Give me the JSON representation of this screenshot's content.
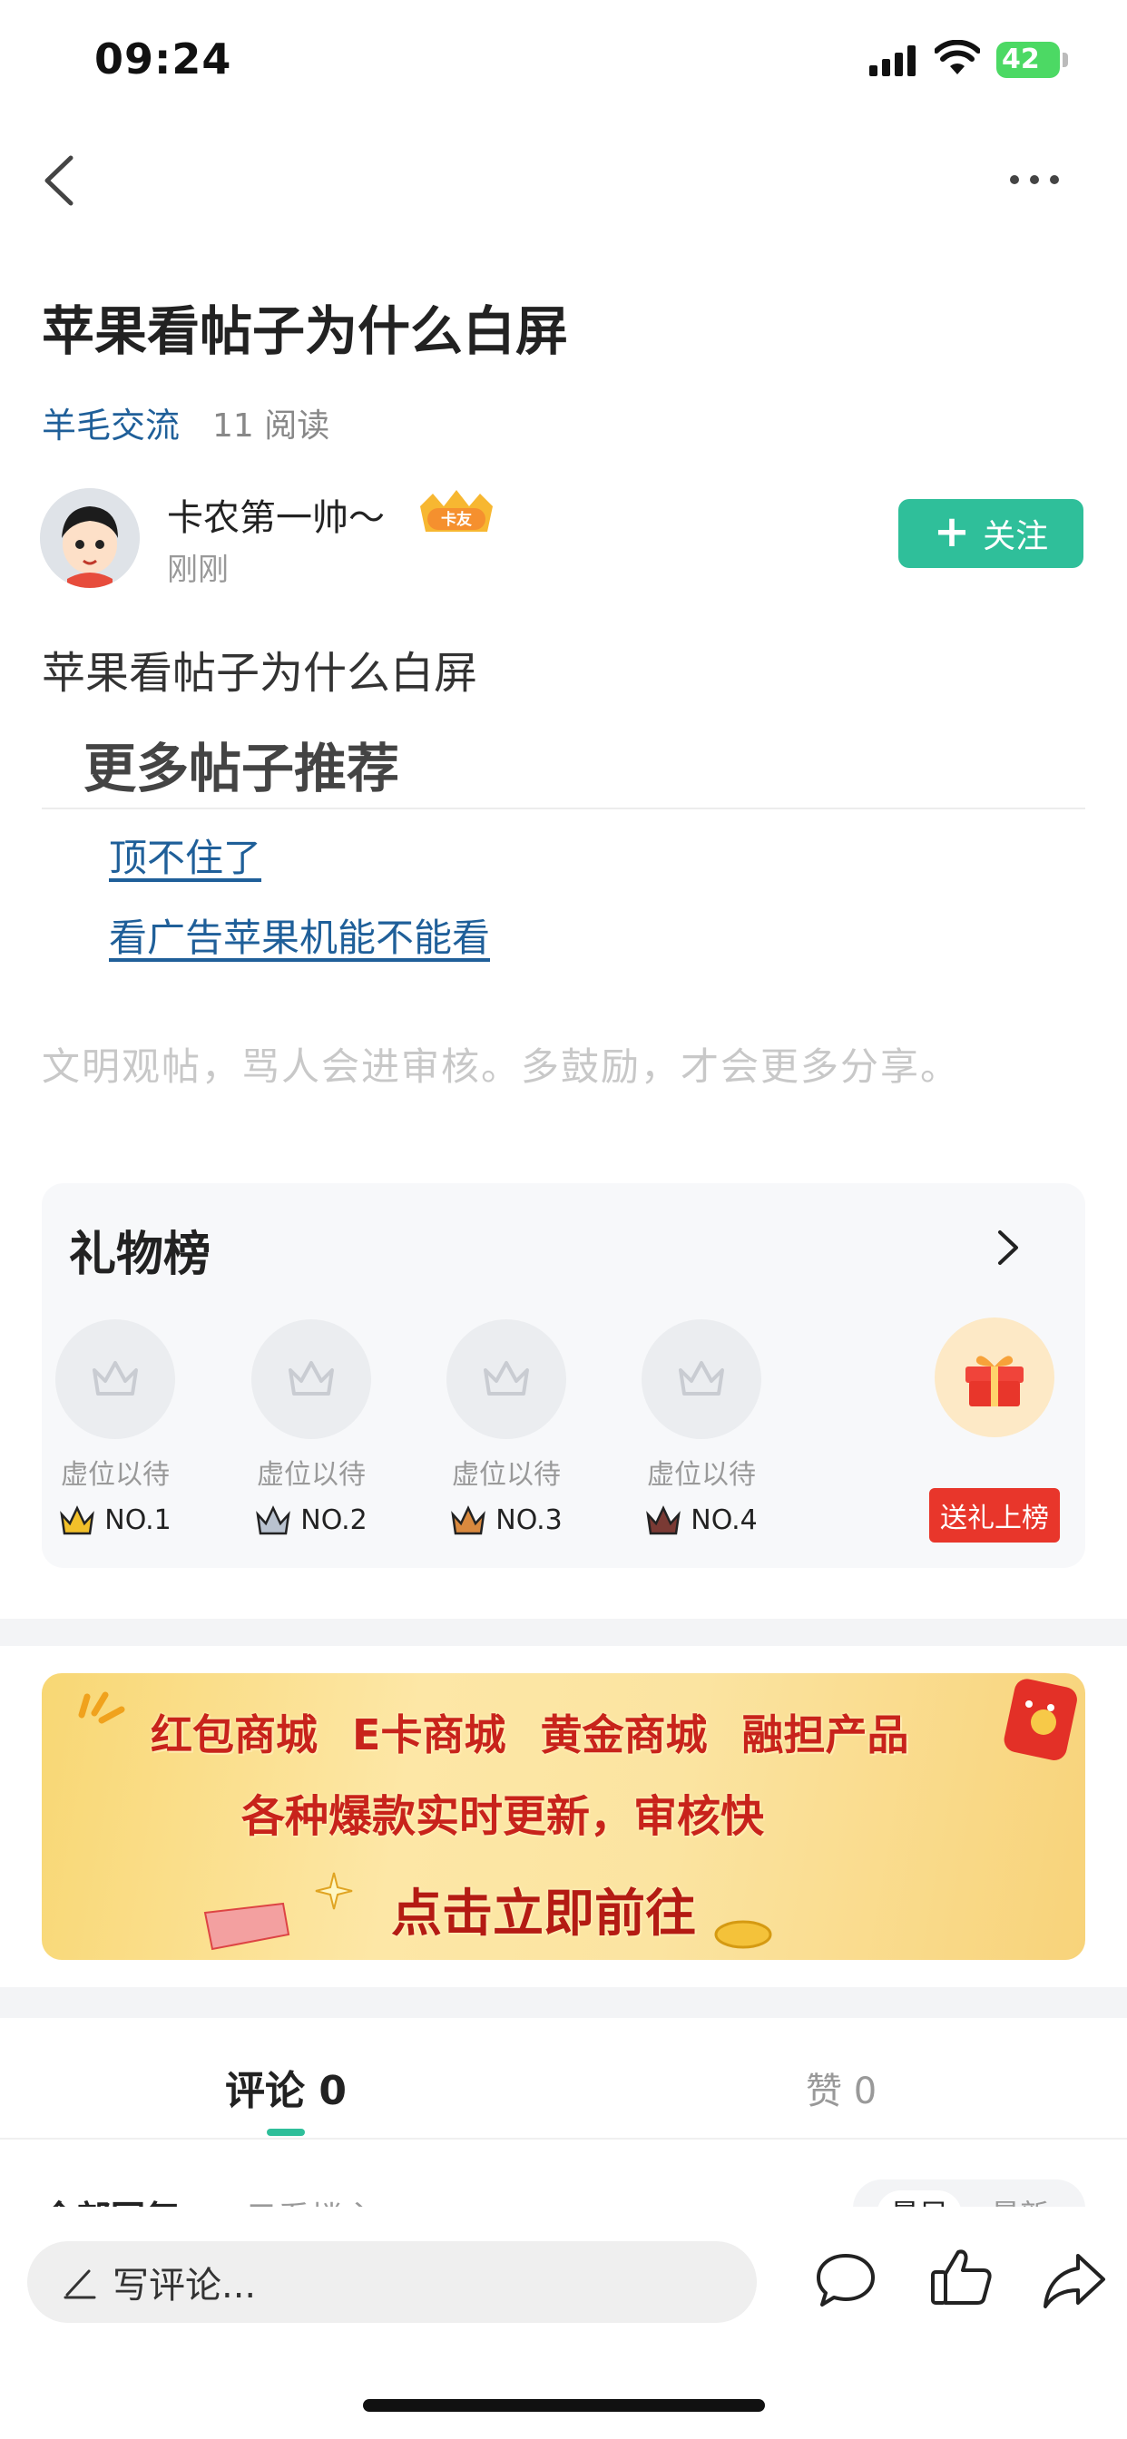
{
  "status_bar": {
    "time": "09:24",
    "battery": "42"
  },
  "post": {
    "title": "苹果看帖子为什么白屏",
    "category": "羊毛交流",
    "reads": "11 阅读",
    "author": {
      "name": "卡农第一帅～",
      "badge": "卡友",
      "time": "刚刚"
    },
    "follow_label": "关注",
    "body": "苹果看帖子为什么白屏",
    "more_heading": "更多帖子推荐",
    "links": [
      "顶不住了",
      "看广告苹果机能不能看"
    ],
    "notice": "文明观帖，骂人会进审核。多鼓励，才会更多分享。"
  },
  "gift_board": {
    "title": "礼物榜",
    "slots": [
      {
        "label": "虚位以待",
        "rank": "NO.1",
        "crown_color": "#f2c02a"
      },
      {
        "label": "虚位以待",
        "rank": "NO.2",
        "crown_color": "#b9c2cf"
      },
      {
        "label": "虚位以待",
        "rank": "NO.3",
        "crown_color": "#d9893e"
      },
      {
        "label": "虚位以待",
        "rank": "NO.4",
        "crown_color": "#7a3a34"
      }
    ],
    "send_label": "送礼上榜"
  },
  "banner": {
    "row1": "红包商城 E卡商城 黄金商城 融担产品",
    "row2": "各种爆款实时更新，审核快",
    "row3": "点击立即前往"
  },
  "tabs": {
    "comments": "评论 0",
    "likes": "赞 0"
  },
  "filters": {
    "all": "全部回复",
    "op_only": "只看楼主",
    "sort_hot": "最早",
    "sort_new": "最新"
  },
  "bottom_bar": {
    "placeholder": "写评论..."
  },
  "colors": {
    "accent": "#2fbf9a",
    "link": "#1f5f99",
    "danger": "#e8362b"
  }
}
